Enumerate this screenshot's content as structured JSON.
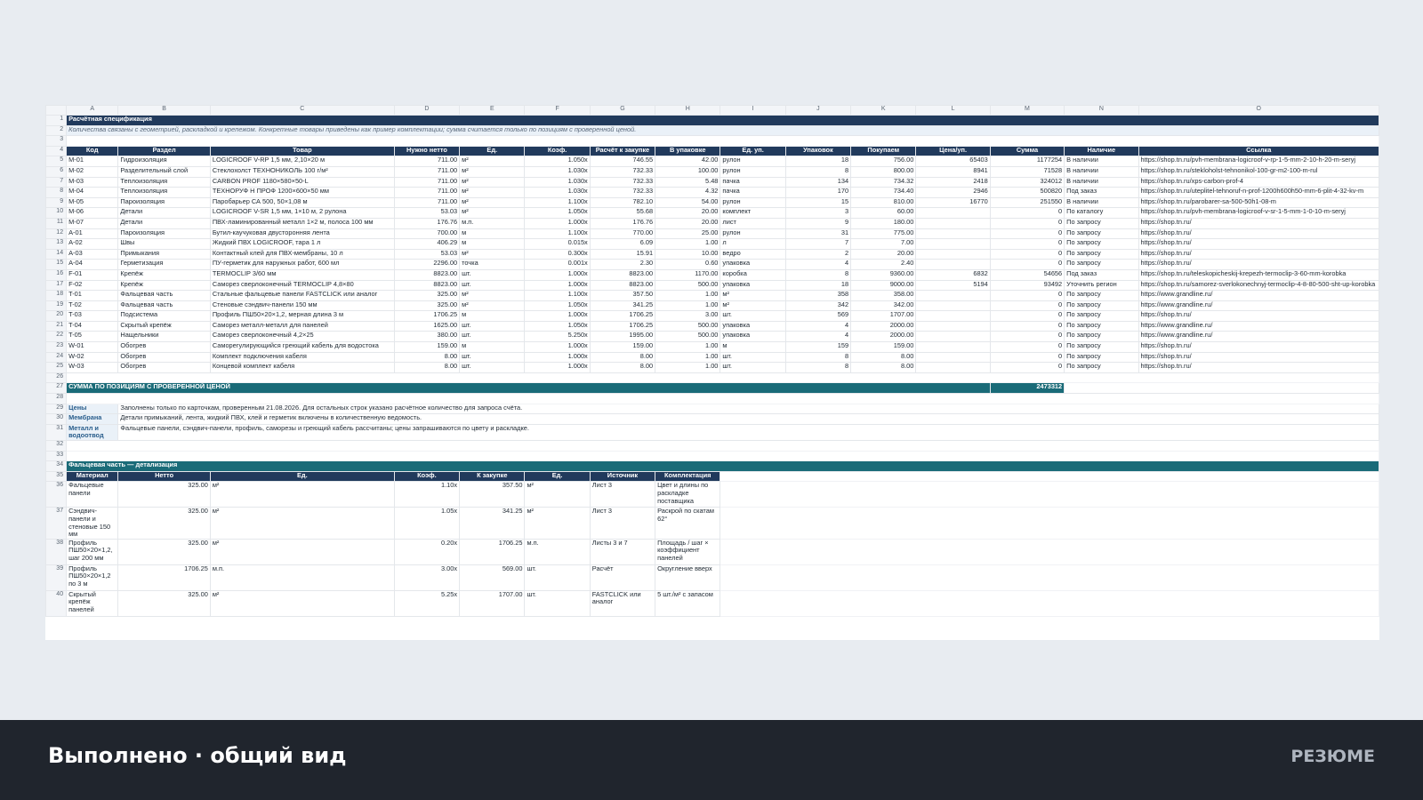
{
  "columns": [
    "A",
    "B",
    "C",
    "D",
    "E",
    "F",
    "G",
    "H",
    "I",
    "J",
    "K",
    "L",
    "M",
    "N",
    "O"
  ],
  "spec": {
    "title": "Расчётная спецификация",
    "note": "Количества связаны с геометрией, раскладкой и крепежом. Конкретные товары приведены как пример комплектации; сумма считается только по позициям с проверенной ценой.",
    "headers": [
      "Код",
      "Раздел",
      "Товар",
      "Нужно нетто",
      "Ед.",
      "Коэф.",
      "Расчёт к закупке",
      "В упаковке",
      "Ед. уп.",
      "Упаковок",
      "Покупаем",
      "Цена/уп.",
      "Сумма",
      "Наличие",
      "Ссылка"
    ],
    "rows": [
      [
        "M-01",
        "Гидроизоляция",
        "LOGICROOF V-RP 1,5 мм, 2,10×20 м",
        "711.00",
        "м²",
        "1.050x",
        "746.55",
        "42.00",
        "рулон",
        "18",
        "756.00",
        "65403",
        "1177254",
        "В наличии",
        "https://shop.tn.ru/pvh-membrana-logicroof-v-rp-1-5-mm-2-10-h-20-m-seryj"
      ],
      [
        "M-02",
        "Разделительный слой",
        "Стеклохолст ТЕХНОНИКОЛЬ 100 г/м²",
        "711.00",
        "м²",
        "1.030x",
        "732.33",
        "100.00",
        "рулон",
        "8",
        "800.00",
        "8941",
        "71528",
        "В наличии",
        "https://shop.tn.ru/stekloholst-tehnonikol-100-gr-m2-100-m-rul"
      ],
      [
        "M-03",
        "Теплоизоляция",
        "CARBON PROF 1180×580×50-L",
        "711.00",
        "м²",
        "1.030x",
        "732.33",
        "5.48",
        "пачка",
        "134",
        "734.32",
        "2418",
        "324012",
        "В наличии",
        "https://shop.tn.ru/xps-carbon-prof-4"
      ],
      [
        "M-04",
        "Теплоизоляция",
        "ТЕХНОРУФ Н ПРОФ 1200×600×50 мм",
        "711.00",
        "м²",
        "1.030x",
        "732.33",
        "4.32",
        "пачка",
        "170",
        "734.40",
        "2946",
        "500820",
        "Под заказ",
        "https://shop.tn.ru/uteplitel-tehnoruf-n-prof-1200h600h50-mm-6-plit-4-32-kv-m"
      ],
      [
        "M-05",
        "Пароизоляция",
        "Паробарьер СА 500, 50×1,08 м",
        "711.00",
        "м²",
        "1.100x",
        "782.10",
        "54.00",
        "рулон",
        "15",
        "810.00",
        "16770",
        "251550",
        "В наличии",
        "https://shop.tn.ru/parobarer-sa-500-50h1-08-m"
      ],
      [
        "M-06",
        "Детали",
        "LOGICROOF V-SR 1,5 мм, 1×10 м, 2 рулона",
        "53.03",
        "м²",
        "1.050x",
        "55.68",
        "20.00",
        "комплект",
        "3",
        "60.00",
        "",
        "0",
        "По каталогу",
        "https://shop.tn.ru/pvh-membrana-logicroof-v-sr-1-5-mm-1-0-10-m-seryj"
      ],
      [
        "M-07",
        "Детали",
        "ПВХ-ламинированный металл 1×2 м, полоса 100 мм",
        "176.76",
        "м.п.",
        "1.000x",
        "176.76",
        "20.00",
        "лист",
        "9",
        "180.00",
        "",
        "0",
        "По запросу",
        "https://shop.tn.ru/"
      ],
      [
        "A-01",
        "Пароизоляция",
        "Бутил-каучуковая двусторонняя лента",
        "700.00",
        "м",
        "1.100x",
        "770.00",
        "25.00",
        "рулон",
        "31",
        "775.00",
        "",
        "0",
        "По запросу",
        "https://shop.tn.ru/"
      ],
      [
        "A-02",
        "Швы",
        "Жидкий ПВХ LOGICROOF, тара 1 л",
        "406.29",
        "м",
        "0.015x",
        "6.09",
        "1.00",
        "л",
        "7",
        "7.00",
        "",
        "0",
        "По запросу",
        "https://shop.tn.ru/"
      ],
      [
        "A-03",
        "Примыкания",
        "Контактный клей для ПВХ-мембраны, 10 л",
        "53.03",
        "м²",
        "0.300x",
        "15.91",
        "10.00",
        "ведро",
        "2",
        "20.00",
        "",
        "0",
        "По запросу",
        "https://shop.tn.ru/"
      ],
      [
        "A-04",
        "Герметизация",
        "ПУ-герметик для наружных работ, 600 мл",
        "2296.00",
        "точка",
        "0.001x",
        "2.30",
        "0.60",
        "упаковка",
        "4",
        "2.40",
        "",
        "0",
        "По запросу",
        "https://shop.tn.ru/"
      ],
      [
        "F-01",
        "Крепёж",
        "TERMOCLIP 3/60 мм",
        "8823.00",
        "шт.",
        "1.000x",
        "8823.00",
        "1170.00",
        "коробка",
        "8",
        "9360.00",
        "6832",
        "54656",
        "Под заказ",
        "https://shop.tn.ru/teleskopicheskij-krepezh-termoclip-3-60-mm-korobka"
      ],
      [
        "F-02",
        "Крепёж",
        "Саморез сверлоконечный TERMOCLIP 4,8×80",
        "8823.00",
        "шт.",
        "1.000x",
        "8823.00",
        "500.00",
        "упаковка",
        "18",
        "9000.00",
        "5194",
        "93492",
        "Уточнить регион",
        "https://shop.tn.ru/samorez-sverlokonechnyj-termoclip-4-8-80-500-sht-up-korobka"
      ],
      [
        "T-01",
        "Фальцевая часть",
        "Стальные фальцевые панели FASTCLICK или аналог",
        "325.00",
        "м²",
        "1.100x",
        "357.50",
        "1.00",
        "м²",
        "358",
        "358.00",
        "",
        "0",
        "По запросу",
        "https://www.grandline.ru/"
      ],
      [
        "T-02",
        "Фальцевая часть",
        "Стеновые сэндвич-панели 150 мм",
        "325.00",
        "м²",
        "1.050x",
        "341.25",
        "1.00",
        "м²",
        "342",
        "342.00",
        "",
        "0",
        "По запросу",
        "https://www.grandline.ru/"
      ],
      [
        "T-03",
        "Подсистема",
        "Профиль ПШ50×20×1,2, мерная длина 3 м",
        "1706.25",
        "м",
        "1.000x",
        "1706.25",
        "3.00",
        "шт.",
        "569",
        "1707.00",
        "",
        "0",
        "По запросу",
        "https://shop.tn.ru/"
      ],
      [
        "T-04",
        "Скрытый крепёж",
        "Саморез металл-металл для панелей",
        "1625.00",
        "шт.",
        "1.050x",
        "1706.25",
        "500.00",
        "упаковка",
        "4",
        "2000.00",
        "",
        "0",
        "По запросу",
        "https://www.grandline.ru/"
      ],
      [
        "T-05",
        "Нащельники",
        "Саморез сверлоконечный 4,2×25",
        "380.00",
        "шт.",
        "5.250x",
        "1995.00",
        "500.00",
        "упаковка",
        "4",
        "2000.00",
        "",
        "0",
        "По запросу",
        "https://www.grandline.ru/"
      ],
      [
        "W-01",
        "Обогрев",
        "Саморегулирующийся греющий кабель для водостока",
        "159.00",
        "м",
        "1.000x",
        "159.00",
        "1.00",
        "м",
        "159",
        "159.00",
        "",
        "0",
        "По запросу",
        "https://shop.tn.ru/"
      ],
      [
        "W-02",
        "Обогрев",
        "Комплект подключения кабеля",
        "8.00",
        "шт.",
        "1.000x",
        "8.00",
        "1.00",
        "шт.",
        "8",
        "8.00",
        "",
        "0",
        "По запросу",
        "https://shop.tn.ru/"
      ],
      [
        "W-03",
        "Обогрев",
        "Концевой комплект кабеля",
        "8.00",
        "шт.",
        "1.000x",
        "8.00",
        "1.00",
        "шт.",
        "8",
        "8.00",
        "",
        "0",
        "По запросу",
        "https://shop.tn.ru/"
      ]
    ],
    "total_label": "СУММА ПО ПОЗИЦИЯМ С ПРОВЕРЕННОЙ ЦЕНОЙ",
    "total_value": "2473312",
    "notes": [
      {
        "label": "Цены",
        "text": "Заполнены только по карточкам, проверенным 21.08.2026. Для остальных строк указано расчётное количество для запроса счёта."
      },
      {
        "label": "Мембрана",
        "text": "Детали примыканий, лента, жидкий ПВХ, клей и герметик включены в количественную ведомость."
      },
      {
        "label": "Металл и водоотвод",
        "text": "Фальцевые панели, сэндвич-панели, профиль, саморезы и греющий кабель рассчитаны; цены запрашиваются по цвету и раскладке."
      }
    ]
  },
  "detail": {
    "title": "Фальцевая часть — детализация",
    "headers": [
      "Материал",
      "Нетто",
      "Ед.",
      "Коэф.",
      "К закупке",
      "Ед.",
      "Источник",
      "Комплектация"
    ],
    "rows": [
      [
        "Фальцевые панели",
        "325.00",
        "м²",
        "1.10x",
        "357.50",
        "м²",
        "Лист 3",
        "Цвет и длины по раскладке поставщика"
      ],
      [
        "Сэндвич-панели и стеновые 150 мм",
        "325.00",
        "м²",
        "1.05x",
        "341.25",
        "м²",
        "Лист 3",
        "Раскрой по скатам 62°"
      ],
      [
        "Профиль ПШ50×20×1,2, шаг 200 мм",
        "325.00",
        "м²",
        "0.20x",
        "1706.25",
        "м.п.",
        "Листы 3 и 7",
        "Площадь / шаг × коэффициент панелей"
      ],
      [
        "Профиль ПШ50×20×1,2 по 3 м",
        "1706.25",
        "м.п.",
        "3.00x",
        "569.00",
        "шт.",
        "Расчёт",
        "Округление вверх"
      ],
      [
        "Скрытый крепёж панелей",
        "325.00",
        "м²",
        "5.25x",
        "1707.00",
        "шт.",
        "FASTCLICK или аналог",
        "5 шт./м² с запасом"
      ]
    ]
  },
  "footer": {
    "title": "Выполнено · общий вид",
    "right": "РЕЗЮМЕ"
  }
}
